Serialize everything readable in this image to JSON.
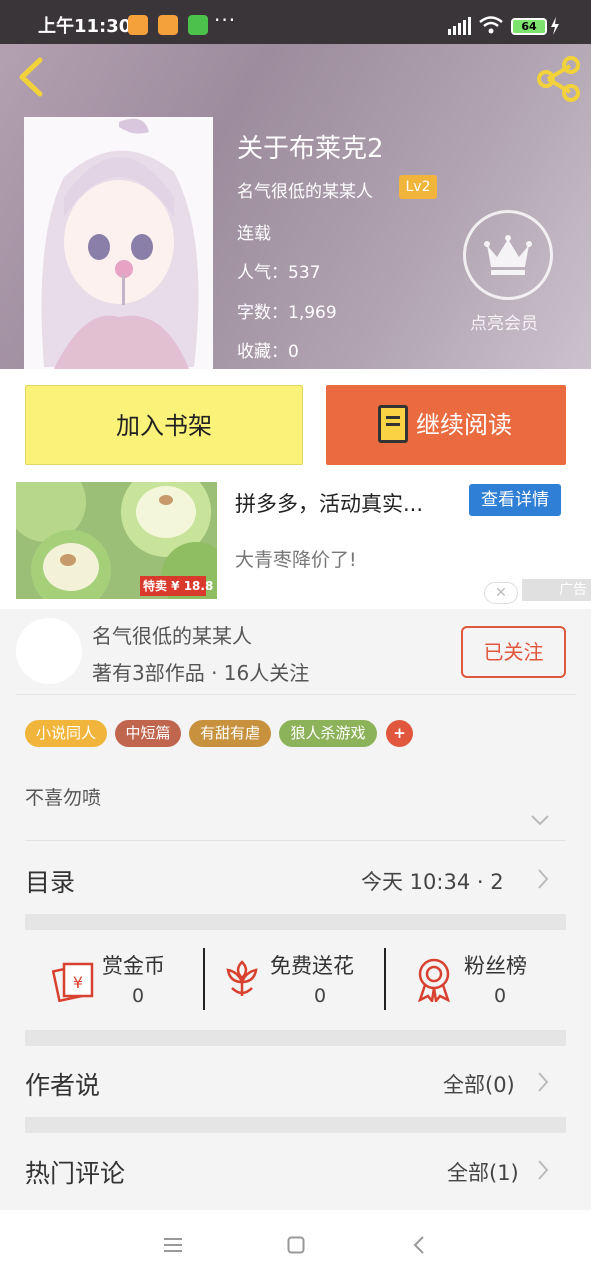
{
  "status_bar": {
    "time": "上午11:30",
    "more": "···",
    "battery": "64",
    "icon_colors": [
      "#f5a13b",
      "#f5a13b",
      "#4cc24c"
    ]
  },
  "header": {
    "back_icon": "chevron-left-icon",
    "share_icon": "share-icon",
    "title": "关于布莱克2",
    "author": "名气很低的某某人",
    "level": "Lv2",
    "status": "连载",
    "popularity": "人气：537",
    "word_count": "字数：1,969",
    "favorites": "收藏：0",
    "vip_label": "点亮会员"
  },
  "actions": {
    "add_shelf": "加入书架",
    "continue_read": "继续阅读"
  },
  "ad": {
    "title": "拼多多，活动真实...",
    "button": "查看详情",
    "subtitle": "大青枣降价了!",
    "price_badge": "特卖 ¥ 18.8",
    "ad_label": "广告",
    "close": "✕"
  },
  "author_card": {
    "name": "名气很低的某某人",
    "stats": "著有3部作品 · 16人关注",
    "follow_button": "已关注"
  },
  "tags": [
    {
      "label": "小说同人",
      "color": "#f2b53c"
    },
    {
      "label": "中短篇",
      "color": "#c0664f"
    },
    {
      "label": "有甜有虐",
      "color": "#c7913e"
    },
    {
      "label": "狼人杀游戏",
      "color": "#8db35a"
    },
    {
      "label": "+",
      "color": "#e0573d"
    }
  ],
  "description": "不喜勿喷",
  "toc": {
    "title": "目录",
    "update": "今天 10:34 · 2"
  },
  "stats": [
    {
      "label": "赏金币",
      "value": "0",
      "icon": "red-envelope-icon"
    },
    {
      "label": "免费送花",
      "value": "0",
      "icon": "flower-icon"
    },
    {
      "label": "粉丝榜",
      "value": "0",
      "icon": "medal-icon"
    }
  ],
  "author_says": {
    "title": "作者说",
    "all": "全部(0)"
  },
  "hot_comments": {
    "title": "热门评论",
    "all": "全部(1)"
  },
  "nav_bar": {
    "menu_icon": "menu-icon",
    "home_icon": "home-square-icon",
    "back_icon": "back-icon"
  }
}
